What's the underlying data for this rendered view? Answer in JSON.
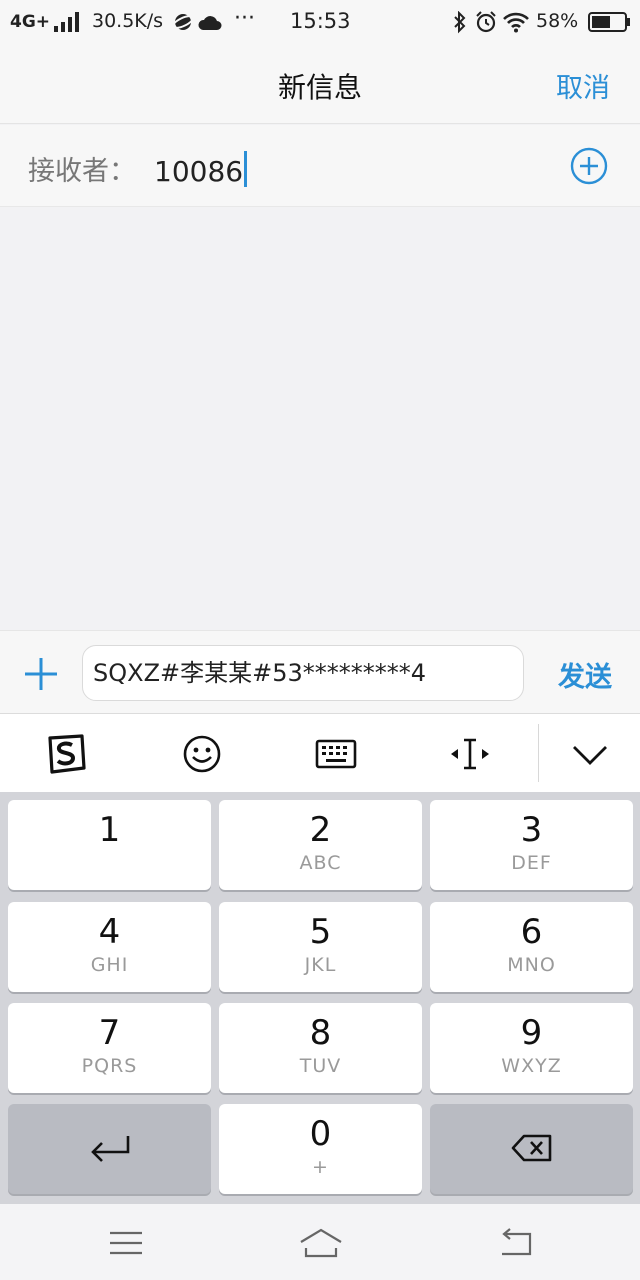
{
  "status_bar": {
    "network": "4G+",
    "speed": "30.5K/s",
    "more": "···",
    "time": "15:53",
    "battery": "58%",
    "battery_level": 0.58
  },
  "nav": {
    "title": "新信息",
    "cancel_label": "取消"
  },
  "recipient": {
    "label": "接收者：",
    "value": "10086"
  },
  "compose": {
    "message": "SQXZ#李某某#53*********4",
    "send_label": "发送"
  },
  "keyboard": {
    "tools": [
      "sogou-logo-icon",
      "emoji-icon",
      "keyboard-icon",
      "cursor-move-icon",
      "collapse-keyboard-icon"
    ],
    "keys": [
      {
        "num": "1",
        "letters": ""
      },
      {
        "num": "2",
        "letters": "ABC"
      },
      {
        "num": "3",
        "letters": "DEF"
      },
      {
        "num": "4",
        "letters": "GHI"
      },
      {
        "num": "5",
        "letters": "JKL"
      },
      {
        "num": "6",
        "letters": "MNO"
      },
      {
        "num": "7",
        "letters": "PQRS"
      },
      {
        "num": "8",
        "letters": "TUV"
      },
      {
        "num": "9",
        "letters": "WXYZ"
      },
      {
        "num": "0",
        "letters": "+"
      }
    ]
  },
  "colors": {
    "accent": "#2b8fd6",
    "keypad_bg": "#d3d4d9",
    "function_key": "#b9bbc2"
  }
}
